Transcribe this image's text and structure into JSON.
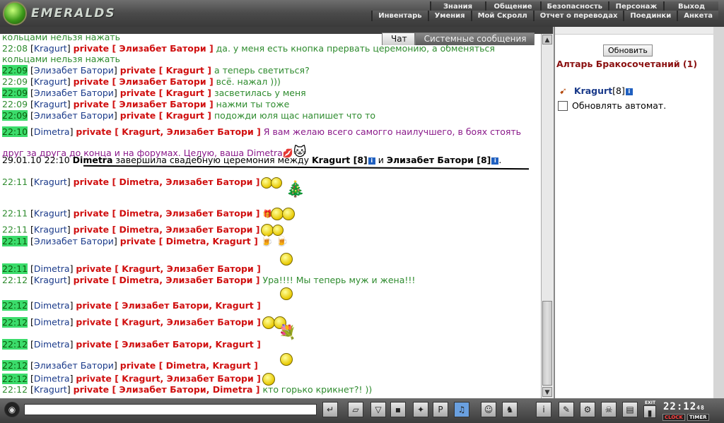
{
  "app": {
    "logo_text": "EMERALDS"
  },
  "menu": {
    "row1": [
      "Знания",
      "Общение",
      "Безопасность",
      "Персонаж",
      "Выход"
    ],
    "row2": [
      "Инвентарь",
      "Умения",
      "Мой Скролл",
      "Отчет о переводах",
      "Поединки",
      "Анкета"
    ]
  },
  "tabs": {
    "chat": "Чат",
    "system": "Системные сообщения"
  },
  "chat": {
    "top_fragment": "кольцами нельзя нажать",
    "messages": [
      {
        "time": "22:08",
        "nick": "Kragurt",
        "private": "private [ Элизабет Батори ]",
        "text": "да. у меня есть кнопка прервать церемонию, а обменяться",
        "highlight": false
      },
      {
        "continuation": "кольцами нельзя нажать"
      },
      {
        "time": "22:09",
        "nick": "Элизабет Батори",
        "private": "private [ Kragurt ]",
        "text": "а теперь светиться?",
        "highlight": true
      },
      {
        "time": "22:09",
        "nick": "Kragurt",
        "private": "private [ Элизабет Батори ]",
        "text": "всё. нажал )))",
        "highlight": false
      },
      {
        "time": "22:09",
        "nick": "Элизабет Батори",
        "private": "private [ Kragurt ]",
        "text": "засветилась у меня",
        "highlight": true
      },
      {
        "time": "22:09",
        "nick": "Kragurt",
        "private": "private [ Элизабет Батори ]",
        "text": "нажми ты тоже",
        "highlight": false
      },
      {
        "time": "22:09",
        "nick": "Элизабет Батори",
        "private": "private [ Kragurt ]",
        "text": "подожди юля щас напишет что то",
        "highlight": true
      },
      {
        "time": "22:10",
        "nick": "Dimetra",
        "private": "private [ Kragurt, Элизабет Батори ]",
        "text": "Я вам желаю всего самогго наилучшего, в боях стоять друг за друга до конца и на форумах. Целую, ваша Dimetra",
        "highlight": true
      },
      {
        "system": true,
        "datetime": "29.01.10 22:10",
        "actor": "Dimetra",
        "text_a": "завершила свадебную церемония между",
        "p1": "Kragurt [8]",
        "and": "и",
        "p2": "Элизабет Батори [8]"
      },
      {
        "time": "22:11",
        "nick": "Kragurt",
        "private": "private [ Dimetra, Элизабет Батори ]",
        "text": "",
        "highlight": false
      },
      {
        "time": "22:11",
        "nick": "Kragurt",
        "private": "private [ Dimetra, Элизабет Батори ]",
        "text": "",
        "highlight": false
      },
      {
        "time": "22:11",
        "nick": "Kragurt",
        "private": "private [ Dimetra, Элизабет Батори ]",
        "text": "",
        "highlight": false
      },
      {
        "time": "22:11",
        "nick": "Элизабет Батори",
        "private": "private [ Dimetra, Kragurt ]",
        "text": "",
        "highlight": true
      },
      {
        "time": "22:11",
        "nick": "Dimetra",
        "private": "private [ Kragurt, Элизабет Батори ]",
        "text": "",
        "highlight": true
      },
      {
        "time": "22:12",
        "nick": "Kragurt",
        "private": "private [ Dimetra, Элизабет Батори ]",
        "text": "Ура!!!! Мы теперь муж и жена!!!",
        "highlight": false
      },
      {
        "time": "22:12",
        "nick": "Dimetra",
        "private": "private [ Элизабет Батори, Kragurt ]",
        "text": "",
        "highlight": true
      },
      {
        "time": "22:12",
        "nick": "Dimetra",
        "private": "private [ Kragurt, Элизабет Батори ]",
        "text": "",
        "highlight": true
      },
      {
        "time": "22:12",
        "nick": "Dimetra",
        "private": "private [ Элизабет Батори, Kragurt ]",
        "text": "",
        "highlight": true
      },
      {
        "time": "22:12",
        "nick": "Элизабет Батори",
        "private": "private [ Dimetra, Kragurt ]",
        "text": "",
        "highlight": true
      },
      {
        "time": "22:12",
        "nick": "Dimetra",
        "private": "private [ Kragurt, Элизабет Батори ]",
        "text": "",
        "highlight": true
      },
      {
        "time": "22:12",
        "nick": "Kragurt",
        "private": "private [ Элизабет Батори, Dimetra ]",
        "text": "кто горько крикнет?! ))",
        "highlight": false
      }
    ]
  },
  "right_panel": {
    "refresh_label": "Обновить",
    "room_title": "Алтарь Бракосочетаний (1)",
    "user_nick": "Kragurt",
    "user_level": "[8]",
    "auto_refresh_label": "Обновлять автомат."
  },
  "bottom": {
    "clock": "22:12",
    "clock_seconds": "48",
    "clock_label": "CLOCK",
    "timer_label": "TIMER",
    "exit_label": "EXIT"
  },
  "colors": {
    "private": "#d01010",
    "nick": "#1a3a8a",
    "time_highlight": "#3bdc6b",
    "room_title": "#8a1010"
  }
}
